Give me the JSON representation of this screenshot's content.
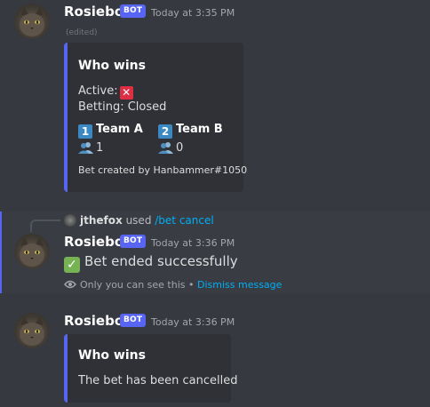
{
  "messages": [
    {
      "username": "Rosiebot",
      "badge": "BOT",
      "timestamp": "Today at 3:35 PM",
      "edited": "(edited)",
      "embed": {
        "title": "Who wins",
        "active_label": "Active:",
        "active_icon": "cross-mark-icon",
        "betting": "Betting: Closed",
        "teams": [
          {
            "number": "1",
            "name": "Team A",
            "count": "1"
          },
          {
            "number": "2",
            "name": "Team B",
            "count": "0"
          }
        ],
        "footer": "Bet created by Hanbammer#1050"
      }
    },
    {
      "reply": {
        "user": "jthefox",
        "used": "used",
        "command": "/bet cancel"
      },
      "username": "Rosiebot",
      "badge": "BOT",
      "timestamp": "Today at 3:36 PM",
      "content": "Bet ended successfully",
      "content_icon": "check-mark-icon",
      "ephemeral_note": "Only you can see this",
      "separator": "•",
      "dismiss": "Dismiss message"
    },
    {
      "username": "Rosiebot",
      "badge": "BOT",
      "timestamp": "Today at 3:36 PM",
      "embed": {
        "title": "Who wins",
        "description": "The bet has been cancelled"
      }
    }
  ],
  "colors": {
    "background": "#36393f",
    "embed_bg": "#2f3136",
    "embed_border": "#5865f2",
    "bot_badge": "#5865f2",
    "link": "#00aff4",
    "highlight_bar": "#5865f2"
  }
}
